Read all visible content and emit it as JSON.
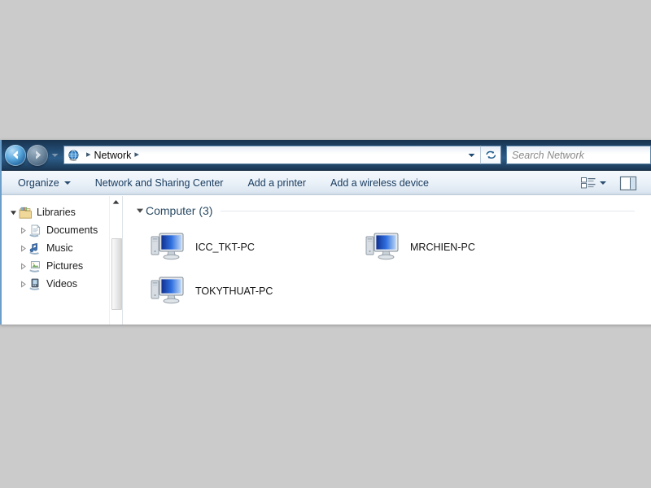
{
  "desktop": {
    "background_color": "#cbcbcb"
  },
  "window": {
    "app": "Windows Explorer",
    "frame_color": "#27557e"
  },
  "addressbar": {
    "back_button_label": "Back",
    "forward_button_label": "Forward",
    "recent_pages_label": "Recent Pages",
    "location_icon": "network-globe-icon",
    "crumb_separator": "▸",
    "breadcrumbs": [
      {
        "label": "Network"
      }
    ],
    "dropdown_label": "Previous Locations",
    "refresh_label": "Refresh",
    "search": {
      "placeholder": "Search Network",
      "value": ""
    }
  },
  "toolbar": {
    "items": [
      {
        "label": "Organize",
        "has_menu": true
      },
      {
        "label": "Network and Sharing Center",
        "has_menu": false
      },
      {
        "label": "Add a printer",
        "has_menu": false
      },
      {
        "label": "Add a wireless device",
        "has_menu": false
      }
    ],
    "change_view_label": "Change your view",
    "change_view_icon": "list-view-icon",
    "preview_pane_label": "Show the preview pane",
    "preview_pane_icon": "preview-pane-icon"
  },
  "navpane": {
    "items": [
      {
        "label": "Libraries",
        "level": 0,
        "expanded": true,
        "icon": "libraries-icon"
      },
      {
        "label": "Documents",
        "level": 1,
        "expanded": false,
        "icon": "documents-icon"
      },
      {
        "label": "Music",
        "level": 1,
        "expanded": false,
        "icon": "music-icon"
      },
      {
        "label": "Pictures",
        "level": 1,
        "expanded": false,
        "icon": "pictures-icon"
      },
      {
        "label": "Videos",
        "level": 1,
        "expanded": false,
        "icon": "videos-icon"
      }
    ],
    "scrollbar": {
      "up_arrow": "scroll-up-arrow"
    }
  },
  "content": {
    "group": {
      "title": "Computer (3)",
      "expanded": true
    },
    "items": [
      {
        "name": "ICC_TKT-PC",
        "icon": "computer-icon"
      },
      {
        "name": "MRCHIEN-PC",
        "icon": "computer-icon"
      },
      {
        "name": "TOKYTHUAT-PC",
        "icon": "computer-icon"
      }
    ]
  }
}
